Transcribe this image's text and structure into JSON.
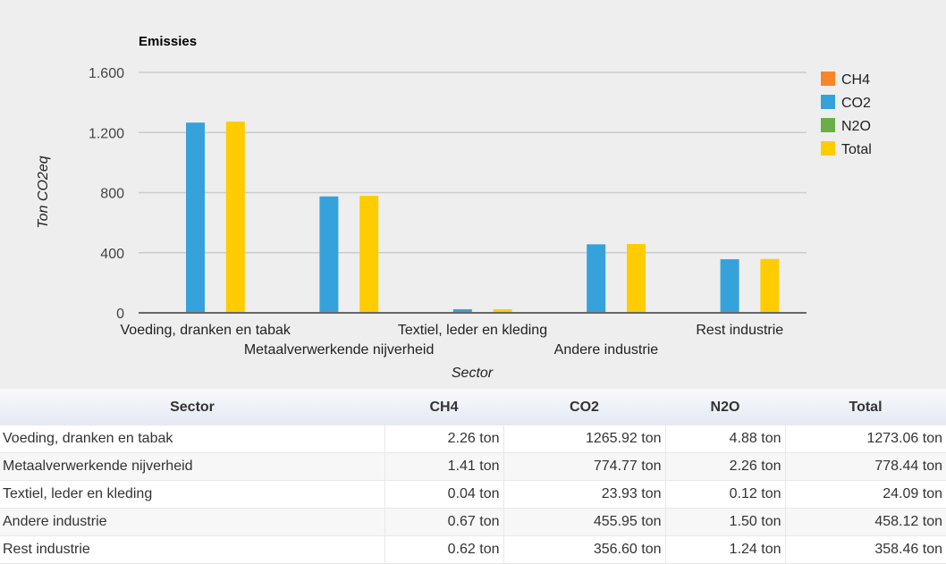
{
  "chart_data": {
    "type": "bar",
    "title": "Emissies",
    "xlabel": "Sector",
    "ylabel": "Ton CO2eq",
    "ylim": [
      0,
      1600
    ],
    "yticks": [
      0,
      400,
      800,
      1200,
      1600
    ],
    "ytick_labels": [
      "0",
      "400",
      "800",
      "1.200",
      "1.600"
    ],
    "grid": true,
    "legend_position": "right",
    "categories": [
      "Voeding, dranken en tabak",
      "Metaalverwerkende nijverheid",
      "Textiel, leder en kleding",
      "Andere industrie",
      "Rest industrie"
    ],
    "series": [
      {
        "name": "CH4",
        "color": "#f7862a",
        "values": [
          2.26,
          1.41,
          0.04,
          0.67,
          0.62
        ]
      },
      {
        "name": "CO2",
        "color": "#36a2db",
        "values": [
          1265.92,
          774.77,
          23.93,
          455.95,
          356.6
        ]
      },
      {
        "name": "N2O",
        "color": "#6aae46",
        "values": [
          4.88,
          2.26,
          0.12,
          1.5,
          1.24
        ]
      },
      {
        "name": "Total",
        "color": "#ffcc00",
        "values": [
          1273.06,
          778.44,
          24.09,
          458.12,
          358.46
        ]
      }
    ]
  },
  "table": {
    "headers": [
      "Sector",
      "CH4",
      "CO2",
      "N2O",
      "Total"
    ],
    "rows": [
      [
        "Voeding, dranken en tabak",
        "2.26 ton",
        "1265.92 ton",
        "4.88 ton",
        "1273.06 ton"
      ],
      [
        "Metaalverwerkende nijverheid",
        "1.41 ton",
        "774.77 ton",
        "2.26 ton",
        "778.44 ton"
      ],
      [
        "Textiel, leder en kleding",
        "0.04 ton",
        "23.93 ton",
        "0.12 ton",
        "24.09 ton"
      ],
      [
        "Andere industrie",
        "0.67 ton",
        "455.95 ton",
        "1.50 ton",
        "458.12 ton"
      ],
      [
        "Rest industrie",
        "0.62 ton",
        "356.60 ton",
        "1.24 ton",
        "358.46 ton"
      ]
    ]
  }
}
